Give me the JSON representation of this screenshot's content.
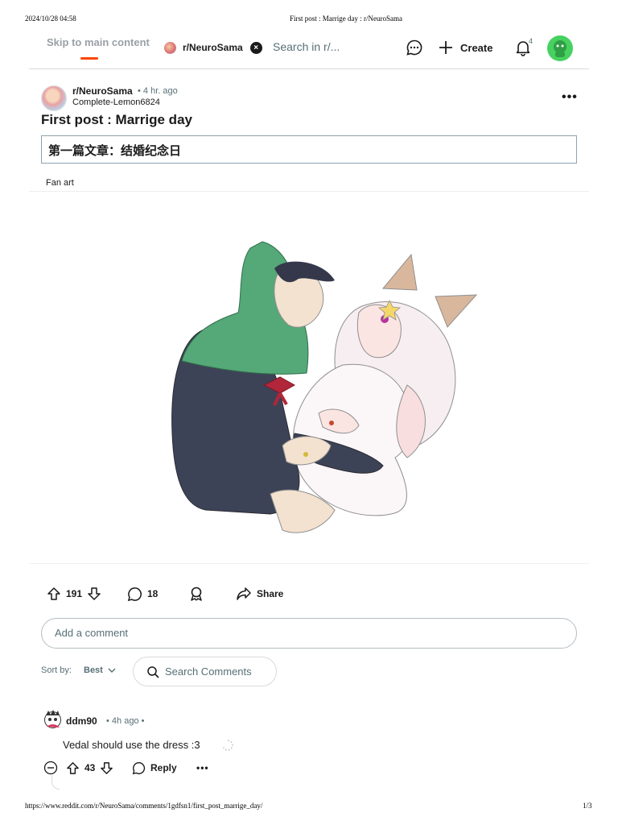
{
  "print": {
    "datetime": "2024/10/28 04:58",
    "title": "First post : Marrige day : r/NeuroSama",
    "url": "https://www.reddit.com/r/NeuroSama/comments/1gdfsn1/first_post_marrige_day/",
    "page": "1/3"
  },
  "header": {
    "skip_link": "Skip to main content",
    "subreddit": "r/NeuroSama",
    "search_placeholder": "Search in r/...",
    "create_label": "Create",
    "notification_count": "4",
    "icons": [
      "chat-icon",
      "plus-icon",
      "bell-icon",
      "user-avatar"
    ]
  },
  "post": {
    "subreddit": "r/NeuroSama",
    "time": "• 4 hr. ago",
    "author": "Complete-Lemon6824",
    "overflow": "•••",
    "title": "First post : Marrige day",
    "body": "第一篇文章：结婚纪念日",
    "flair": "Fan art",
    "upvotes": "191",
    "comments": "18",
    "share_label": "Share"
  },
  "comment_box": {
    "placeholder": "Add a comment"
  },
  "sort": {
    "label": "Sort by:",
    "value": "Best",
    "search_placeholder": "Search Comments"
  },
  "comments": [
    {
      "author": "ddm90",
      "time": "• 4h ago •",
      "body": "Vedal should use the dress :3",
      "votes": "43",
      "reply_label": "Reply",
      "more": "•••"
    }
  ]
}
